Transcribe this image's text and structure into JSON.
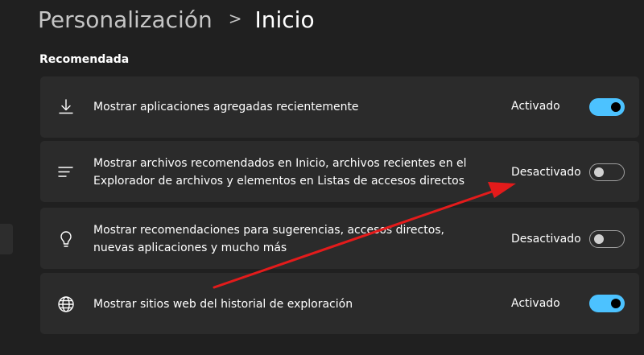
{
  "header": {
    "parent": "Personalización",
    "separator": ">",
    "current": "Inicio"
  },
  "section": {
    "title": "Recomendada"
  },
  "settings": [
    {
      "icon": "download-icon",
      "text": "Mostrar aplicaciones agregadas recientemente",
      "state": "Activado",
      "on": true
    },
    {
      "icon": "list-lines-icon",
      "text": "Mostrar archivos recomendados en Inicio, archivos recientes en el Explorador de archivos y elementos en Listas de accesos directos",
      "state": "Desactivado",
      "on": false
    },
    {
      "icon": "lightbulb-icon",
      "text": "Mostrar recomendaciones para sugerencias, accesos directos, nuevas aplicaciones y mucho más",
      "state": "Desactivado",
      "on": false
    },
    {
      "icon": "globe-icon",
      "text": "Mostrar sitios web del historial de exploración",
      "state": "Activado",
      "on": true
    }
  ],
  "colors": {
    "background": "#202020",
    "card": "#2b2b2b",
    "accent": "#4cc2ff",
    "annotation_arrow": "#e31b1b"
  }
}
